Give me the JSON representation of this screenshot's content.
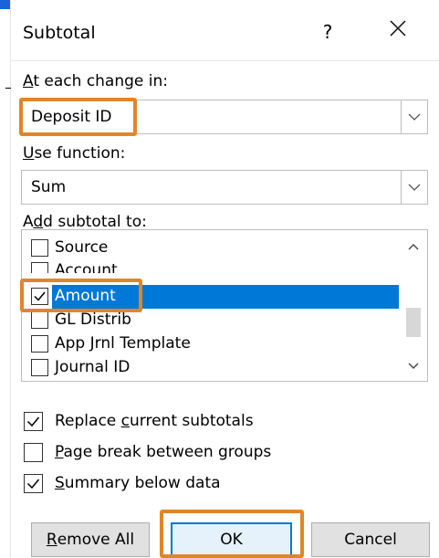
{
  "dialog": {
    "title": "Subtotal",
    "help_label": "?",
    "close_icon": "close-icon"
  },
  "at_each_change": {
    "label_mnemonic": "A",
    "label_rest": "t each change in:",
    "value": "Deposit ID"
  },
  "use_function": {
    "label_mnemonic": "U",
    "label_rest": "se function:",
    "value": "Sum"
  },
  "add_subtotal": {
    "label_pre": "A",
    "label_mnemonic": "d",
    "label_rest": "d subtotal to:",
    "items": [
      {
        "label": "Source",
        "checked": false,
        "selected": false
      },
      {
        "label": "Account",
        "checked": false,
        "selected": false
      },
      {
        "label": "Amount",
        "checked": true,
        "selected": true
      },
      {
        "label": "GL Distrib",
        "checked": false,
        "selected": false
      },
      {
        "label": "App Jrnl Template",
        "checked": false,
        "selected": false
      },
      {
        "label": "Journal ID",
        "checked": false,
        "selected": false
      }
    ]
  },
  "options": {
    "replace": {
      "pre": "Replace ",
      "mnemonic": "c",
      "rest": "urrent subtotals",
      "checked": true
    },
    "page_break": {
      "pre": "",
      "mnemonic": "P",
      "rest": "age break between groups",
      "checked": false
    },
    "summary": {
      "pre": "",
      "mnemonic": "S",
      "rest": "ummary below data",
      "checked": true
    }
  },
  "buttons": {
    "remove_all": {
      "mnemonic": "R",
      "rest": "emove All"
    },
    "ok": "OK",
    "cancel": "Cancel"
  },
  "colors": {
    "highlight": "#e0862a",
    "selection": "#0078d7",
    "accent_mark": "#1b63d8"
  }
}
